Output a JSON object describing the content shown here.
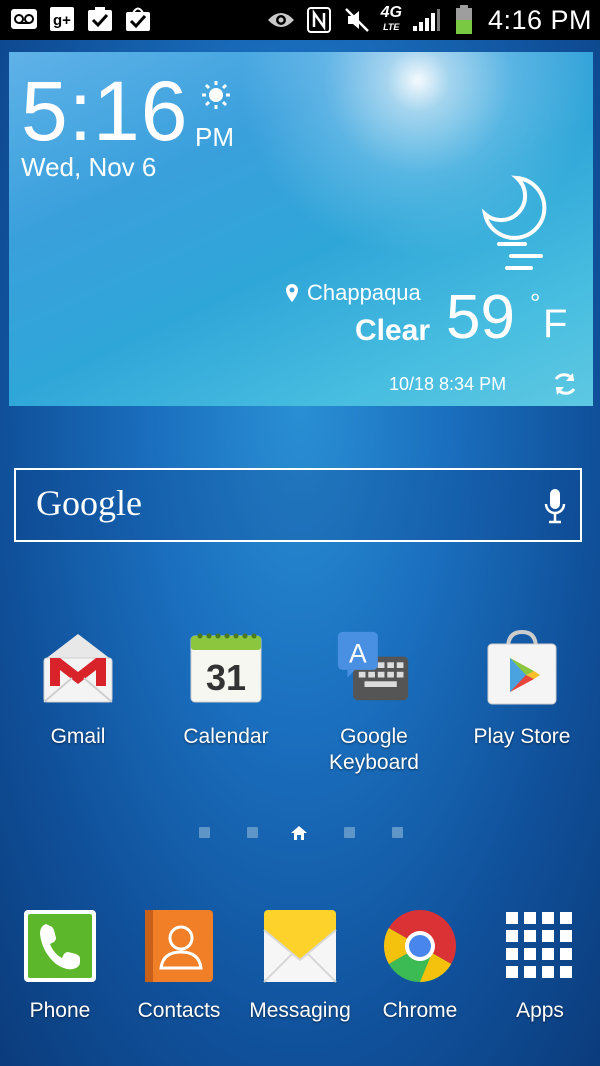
{
  "status_bar": {
    "time": "4:16 PM",
    "network": "4G",
    "network_sub": "LTE",
    "battery_color": "#7ac943",
    "left_icons": [
      "voicemail-icon",
      "google-plus-icon",
      "task-check-icon",
      "shopping-bag-check-icon"
    ],
    "right_icons": [
      "eye-icon",
      "nfc-icon",
      "mute-icon",
      "network-4g-lte-icon",
      "signal-icon",
      "battery-icon"
    ]
  },
  "weather_widget": {
    "time": "5:16",
    "ampm": "PM",
    "date": "Wed, Nov 6",
    "location": "Chappaqua",
    "condition": "Clear",
    "temperature": "59",
    "degree": "°",
    "unit": "F",
    "updated": "10/18 8:34 PM"
  },
  "search": {
    "logo": "Google"
  },
  "apps": [
    {
      "label": "Gmail"
    },
    {
      "label": "Calendar",
      "day": "31"
    },
    {
      "label": "Google Keyboard",
      "glyph": "A"
    },
    {
      "label": "Play Store"
    }
  ],
  "page_indicator": {
    "pages": 5,
    "current": 3
  },
  "dock": [
    {
      "label": "Phone"
    },
    {
      "label": "Contacts"
    },
    {
      "label": "Messaging"
    },
    {
      "label": "Chrome"
    },
    {
      "label": "Apps"
    }
  ]
}
